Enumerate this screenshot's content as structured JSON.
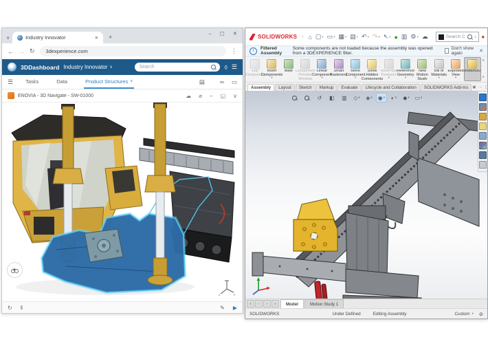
{
  "colors": {
    "brand_blue": "#1d5a8a",
    "accent_blue": "#3a8fd0",
    "sw_red": "#d8262c",
    "selection_cyan": "#54c7f0",
    "machine_yellow": "#e0b446",
    "selected_frame_blue": "#2d6ca8"
  },
  "browser": {
    "tab": {
      "title": "Industry Innovator",
      "close_glyph": "✕",
      "new_tab_glyph": "+",
      "search_tabs_glyph": "∨"
    },
    "window_controls": {
      "minimize": "–",
      "maximize": "▢",
      "close": "✕"
    },
    "address": {
      "back": "←",
      "forward": "→",
      "reload": "↻",
      "url": "3dexperience.com",
      "menu": "⋮"
    },
    "appbar": {
      "product": "3DDashboard",
      "dashboard": "Industry Innovator",
      "caret": "∨",
      "search_placeholder": "Search",
      "tag_glyph": "◊",
      "menu_glyph": "☰"
    },
    "nav": {
      "menu_glyph": "☰",
      "items": [
        {
          "name": "nav-item-tasks",
          "label": "Tasks"
        },
        {
          "name": "nav-item-data",
          "label": "Data"
        },
        {
          "name": "nav-item-product-structures",
          "label": "Product Structures",
          "active": true,
          "dropdown": true
        }
      ],
      "tools": [
        {
          "name": "display-options-icon",
          "glyph": "▤"
        },
        {
          "name": "explore-search-icon",
          "glyph": "",
          "magnifier": true
        },
        {
          "name": "vr-goggles-icon",
          "glyph": "∞"
        },
        {
          "name": "comments-icon",
          "glyph": "▭"
        }
      ]
    },
    "widget": {
      "title": "ENOVIA - 3D Navigate - SW-01000",
      "tools": [
        {
          "name": "cloud-icon",
          "glyph": "☁"
        },
        {
          "name": "attach-icon",
          "glyph": "⌀"
        },
        {
          "name": "minimize-widget-icon",
          "glyph": "–"
        },
        {
          "name": "expand-widget-icon",
          "glyph": "◱"
        },
        {
          "name": "collapse-widget-icon",
          "glyph": "∨"
        }
      ]
    },
    "footer": {
      "left": [
        {
          "name": "orbit-icon",
          "glyph": "↻"
        },
        {
          "name": "pause-icon",
          "glyph": "‖"
        }
      ],
      "right": [
        {
          "name": "edit-3d-icon",
          "glyph": "✎"
        },
        {
          "name": "play-3d-icon",
          "glyph": "▶",
          "style": "color:#2d7dd2"
        }
      ]
    }
  },
  "sw": {
    "brand": "SOLIDWORKS",
    "brand_caret": "›",
    "quick_toolbar": [
      {
        "name": "home-icon",
        "glyph": "⌂"
      },
      {
        "name": "new-document-icon",
        "glyph": "▢",
        "dropdown": true
      },
      {
        "name": "open-icon",
        "glyph": "▭",
        "dropdown": true
      },
      {
        "name": "save-icon",
        "glyph": "▦",
        "dropdown": true
      },
      {
        "name": "print-icon",
        "glyph": "▤",
        "dropdown": true
      },
      {
        "name": "undo-icon",
        "glyph": "↶",
        "dropdown": true
      },
      {
        "name": "redo-icon",
        "glyph": "↷",
        "dropdown": true,
        "style": "color:#bcbcbc"
      },
      {
        "name": "select-icon",
        "glyph": "↖",
        "dropdown": true,
        "style": "color:#2f6fb0"
      },
      {
        "name": "rebuild-icon",
        "glyph": "●",
        "style": "color:#2aa12e"
      },
      {
        "name": "file-properties-icon",
        "glyph": "▥"
      },
      {
        "name": "options-icon",
        "glyph": "⚙",
        "dropdown": true
      },
      {
        "name": "cloud-services-icon",
        "glyph": "☁",
        "style": "color:#4d5a66"
      }
    ],
    "search": {
      "placeholder": "Search C",
      "caret": "∨"
    },
    "title_right": [
      {
        "name": "help-lifesaver-icon",
        "glyph": "●",
        "style": "color:#c8372d"
      },
      {
        "name": "help-icon",
        "glyph": "?"
      }
    ],
    "window_controls": {
      "minimize": "–",
      "layout": "⊞",
      "maximize": "▢",
      "close": "✕"
    },
    "info": {
      "title": "Filtered Assembly",
      "message": "Some components are not loaded because the assembly was opened from a 3DEXPERIENCE filter.",
      "dismiss": "Don't show again",
      "close_glyph": "✕"
    },
    "ribbon": [
      {
        "name": "ribbon-edit-component",
        "label": "Edit Component",
        "disabled": true,
        "ic": "background:linear-gradient(135deg,#e8eef5,#b9c9da)"
      },
      {
        "name": "ribbon-insert-components",
        "label": "Insert Components",
        "dropdown": true,
        "ic": "background:linear-gradient(135deg,#f5e9c8,#dcb75e)"
      },
      {
        "name": "ribbon-mate",
        "label": "Mate",
        "ic": "background:linear-gradient(135deg,#cfe3c8,#8fbb7f)"
      },
      {
        "name": "ribbon-component-preview-window",
        "label": "Component Preview Window",
        "disabled": true,
        "ic": "background:linear-gradient(135deg,#dde4ea,#aab6c2)"
      },
      {
        "name": "ribbon-linear-component-pattern",
        "label": "Linear Component Pattern",
        "dropdown": true,
        "ic": "background:linear-gradient(135deg,#d7e4f2,#7fa7cf)"
      },
      {
        "name": "ribbon-smart-fasteners",
        "label": "Smart Fasteners",
        "ic": "background:linear-gradient(135deg,#e7d9ef,#a98cc5)"
      },
      {
        "name": "ribbon-move-component",
        "label": "Move Component",
        "dropdown": true,
        "ic": "background:linear-gradient(135deg,#d9ecf7,#86bede)"
      },
      {
        "name": "ribbon-show-hidden-components",
        "label": "Show Hidden Components",
        "ic": "background:linear-gradient(135deg,#fdf3cf,#e3c860)"
      },
      {
        "name": "ribbon-assembly-features",
        "label": "Assembly Features",
        "disabled": true,
        "dropdown": true,
        "ic": "background:linear-gradient(135deg,#e2e2e2,#b8b8b8)"
      },
      {
        "name": "ribbon-reference-geometry",
        "label": "Reference Geometry",
        "dropdown": true,
        "ic": "background:linear-gradient(135deg,#cfe9ea,#6fb3b6)"
      },
      {
        "name": "ribbon-new-motion-study",
        "label": "New Motion Study",
        "ic": "background:linear-gradient(135deg,#dfe9d2,#9dbf72)"
      },
      {
        "name": "ribbon-bill-of-materials",
        "label": "Bill of Materials",
        "dropdown": true,
        "ic": "background:linear-gradient(135deg,#f2f2f2,#c2c2c2)"
      },
      {
        "name": "ribbon-exploded-view",
        "label": "Exploded View",
        "dropdown": true,
        "ic": "background:linear-gradient(135deg,#fbe3cd,#e7a45e)"
      },
      {
        "name": "ribbon-instant3d",
        "label": "Instant3D",
        "selected": true,
        "ic": "background:linear-gradient(135deg,#fdf0c0,#ddb23c)"
      }
    ],
    "ribbon_overflow": "»",
    "ribbon_collapse": "˄",
    "tabs": [
      {
        "name": "tab-assembly",
        "label": "Assembly",
        "active": true
      },
      {
        "name": "tab-layout",
        "label": "Layout"
      },
      {
        "name": "tab-sketch",
        "label": "Sketch"
      },
      {
        "name": "tab-markup",
        "label": "Markup"
      },
      {
        "name": "tab-evaluate",
        "label": "Evaluate"
      },
      {
        "name": "tab-lifecycle-and-collaboration",
        "label": "Lifecycle and Collaboration"
      },
      {
        "name": "tab-solidworks-add-ins",
        "label": "SOLIDWORKS Add-Ins"
      }
    ],
    "doc_controls": [
      {
        "name": "doc-cascade-icon",
        "glyph": "▣"
      },
      {
        "name": "doc-minimize-icon",
        "glyph": "–"
      },
      {
        "name": "doc-restore-icon",
        "glyph": "▢"
      },
      {
        "name": "doc-close-icon",
        "glyph": "✕"
      }
    ],
    "headsup": [
      {
        "name": "zoom-fit-icon",
        "glyph": "",
        "magnifier": true
      },
      {
        "name": "zoom-area-icon",
        "glyph": "",
        "magnifier": true
      },
      {
        "name": "previous-view-icon",
        "glyph": "↺"
      },
      {
        "name": "section-view-icon",
        "glyph": "◧"
      },
      {
        "name": "annotation-views-icon",
        "glyph": "▥"
      },
      {
        "name": "view-orientation-icon",
        "glyph": "◇",
        "dropdown": true
      },
      {
        "name": "display-style-icon",
        "glyph": "◈",
        "dropdown": true
      },
      {
        "name": "hide-show-items-icon",
        "glyph": "◉",
        "dropdown": true,
        "selected": true
      },
      {
        "name": "edit-appearance-icon",
        "glyph": "◐",
        "dropdown": true
      },
      {
        "name": "apply-scene-icon",
        "glyph": "◆",
        "dropdown": true
      },
      {
        "name": "view-settings-icon",
        "glyph": "▭",
        "dropdown": true
      }
    ],
    "taskpane": [
      {
        "name": "taskpane-3dexperience-icon",
        "ic": "background:#2d76c2"
      },
      {
        "name": "taskpane-resources-icon",
        "ic": "background:linear-gradient(135deg,#4a90d9,#e8762c)"
      },
      {
        "name": "taskpane-design-library-icon",
        "ic": "background:#d9a842"
      },
      {
        "name": "taskpane-file-explorer-icon",
        "ic": "background:#e8d87a"
      },
      {
        "name": "taskpane-view-palette-icon",
        "ic": "background:#8aa8c8"
      },
      {
        "name": "taskpane-appearances-icon",
        "ic": "background:linear-gradient(135deg,#d94a3a,#3a8ad9,#e8c83a)"
      },
      {
        "name": "taskpane-custom-properties-icon",
        "ic": "background:#5a7a9a"
      },
      {
        "name": "taskpane-collapse-icon",
        "ic": "background:#c8ccd0"
      }
    ],
    "model_nav": [
      {
        "name": "model-nav-first",
        "glyph": "«"
      },
      {
        "name": "model-nav-prev",
        "glyph": "‹"
      },
      {
        "name": "model-nav-next",
        "glyph": "›"
      },
      {
        "name": "model-nav-last",
        "glyph": "»"
      }
    ],
    "model_tabs": [
      {
        "name": "model-tab",
        "label": "Model",
        "active": true
      },
      {
        "name": "motion-study-tab",
        "label": "Motion Study 1"
      }
    ],
    "status": {
      "app": "SOLIDWORKS",
      "defined": "Under Defined",
      "mode": "Editing Assembly",
      "units": "Custom",
      "units_caret": "▾",
      "globe_glyph": "⊛"
    }
  }
}
